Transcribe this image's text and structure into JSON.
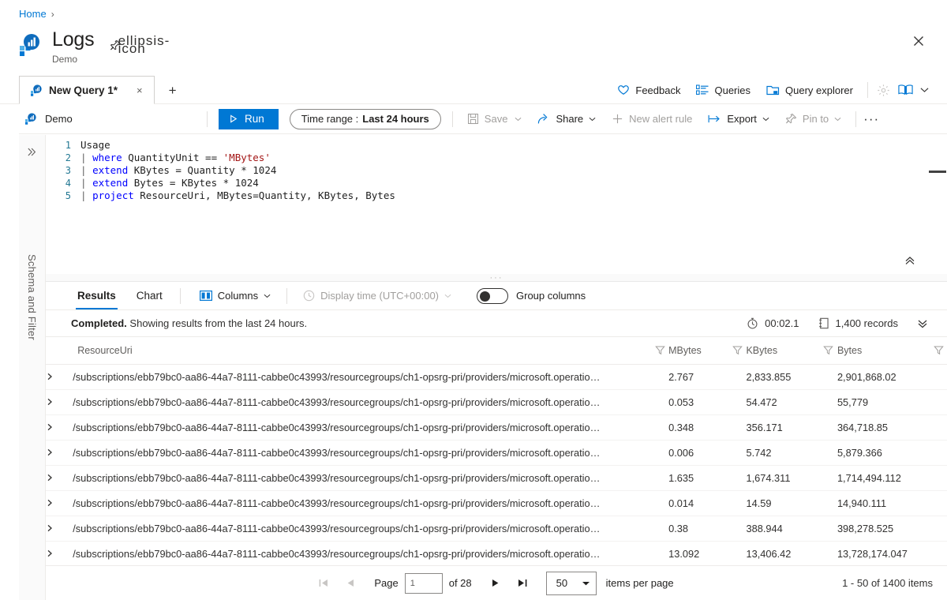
{
  "breadcrumb": {
    "home": "Home"
  },
  "header": {
    "title": "Logs",
    "subtitle": "Demo",
    "pin_icon": "pin-icon",
    "more_icon": "ellipsis-icon",
    "close_icon": "close-icon"
  },
  "tabs": {
    "items": [
      {
        "label": "New Query 1*",
        "icon": "log-analytics-icon",
        "close": "×"
      }
    ],
    "new_tab": "+"
  },
  "top_commands": [
    {
      "label": "Feedback",
      "icon": "heart-icon",
      "disabled": false
    },
    {
      "label": "Queries",
      "icon": "list-icon",
      "disabled": false
    },
    {
      "label": "Query explorer",
      "icon": "folder-open-icon",
      "disabled": false
    }
  ],
  "top_icon_commands": [
    {
      "name": "settings-gear-icon",
      "disabled": true
    },
    {
      "name": "book-help-icon",
      "disabled": false
    }
  ],
  "commandbar": {
    "scope_label": "Demo",
    "scope_icon": "log-analytics-icon",
    "run_label": "Run",
    "run_icon": "play-icon",
    "time_range_prefix": "Time range :",
    "time_range_value": "Last 24 hours",
    "items": [
      {
        "label": "Save",
        "icon": "save-icon",
        "caret": true,
        "disabled": true
      },
      {
        "label": "Share",
        "icon": "share-icon",
        "caret": true,
        "disabled": false
      },
      {
        "label": "New alert rule",
        "icon": "plus-icon",
        "caret": false,
        "disabled": true
      },
      {
        "label": "Export",
        "icon": "export-icon",
        "caret": true,
        "disabled": false
      },
      {
        "label": "Pin to",
        "icon": "pin-icon",
        "caret": true,
        "disabled": true
      }
    ],
    "overflow": "···"
  },
  "rail": {
    "expand_icon": "double-chevron-right-icon",
    "label": "Schema and Filter"
  },
  "editor": {
    "collapse_icon": "double-chevron-up-icon",
    "lines": [
      {
        "n": "1",
        "html": "Usage"
      },
      {
        "n": "2",
        "html": "<span class=\"pipe\">| </span><span class=\"kw\">where</span> QuantityUnit == <span class=\"str\">'MBytes'</span>"
      },
      {
        "n": "3",
        "html": "<span class=\"pipe\">| </span><span class=\"kw\">extend</span> KBytes = Quantity * <span class=\"num\">1024</span>"
      },
      {
        "n": "4",
        "html": "<span class=\"pipe\">| </span><span class=\"kw\">extend</span> Bytes = KBytes * <span class=\"num\">1024</span>"
      },
      {
        "n": "5",
        "html": "<span class=\"pipe\">| </span><span class=\"kw\">project</span> ResourceUri, MBytes=Quantity, KBytes, Bytes"
      }
    ],
    "query_text": "Usage\n| where QuantityUnit == 'MBytes'\n| extend KBytes = Quantity * 1024\n| extend Bytes = KBytes * 1024\n| project ResourceUri, MBytes=Quantity, KBytes, Bytes"
  },
  "splitter": {
    "grip": "···"
  },
  "results_toolbar": {
    "tabs": [
      {
        "label": "Results",
        "active": true
      },
      {
        "label": "Chart",
        "active": false
      }
    ],
    "columns_label": "Columns",
    "columns_icon": "columns-icon",
    "display_time_label": "Display time (UTC+00:00)",
    "display_time_icon": "clock-icon",
    "group_columns_label": "Group columns",
    "group_columns_on": false
  },
  "status": {
    "prefix": "Completed.",
    "message": "Showing results from the last 24 hours.",
    "elapsed": "00:02.1",
    "elapsed_icon": "stopwatch-icon",
    "records": "1,400 records",
    "records_icon": "records-icon",
    "expand_icon": "double-chevron-down-icon"
  },
  "table": {
    "columns": [
      "ResourceUri",
      "MBytes",
      "KBytes",
      "Bytes"
    ],
    "filter_icon": "filter-funnel-icon",
    "row_expand_icon": "chevron-right-icon",
    "rows": [
      {
        "uri": "/subscriptions/ebb79bc0-aa86-44a7-8111-cabbe0c43993/resourcegroups/ch1-opsrg-pri/providers/microsoft.operatio…",
        "mbytes": "2.767",
        "kbytes": "2,833.855",
        "bytes": "2,901,868.02"
      },
      {
        "uri": "/subscriptions/ebb79bc0-aa86-44a7-8111-cabbe0c43993/resourcegroups/ch1-opsrg-pri/providers/microsoft.operatio…",
        "mbytes": "0.053",
        "kbytes": "54.472",
        "bytes": "55,779"
      },
      {
        "uri": "/subscriptions/ebb79bc0-aa86-44a7-8111-cabbe0c43993/resourcegroups/ch1-opsrg-pri/providers/microsoft.operatio…",
        "mbytes": "0.348",
        "kbytes": "356.171",
        "bytes": "364,718.85"
      },
      {
        "uri": "/subscriptions/ebb79bc0-aa86-44a7-8111-cabbe0c43993/resourcegroups/ch1-opsrg-pri/providers/microsoft.operatio…",
        "mbytes": "0.006",
        "kbytes": "5.742",
        "bytes": "5,879.366"
      },
      {
        "uri": "/subscriptions/ebb79bc0-aa86-44a7-8111-cabbe0c43993/resourcegroups/ch1-opsrg-pri/providers/microsoft.operatio…",
        "mbytes": "1.635",
        "kbytes": "1,674.311",
        "bytes": "1,714,494.112"
      },
      {
        "uri": "/subscriptions/ebb79bc0-aa86-44a7-8111-cabbe0c43993/resourcegroups/ch1-opsrg-pri/providers/microsoft.operatio…",
        "mbytes": "0.014",
        "kbytes": "14.59",
        "bytes": "14,940.111"
      },
      {
        "uri": "/subscriptions/ebb79bc0-aa86-44a7-8111-cabbe0c43993/resourcegroups/ch1-opsrg-pri/providers/microsoft.operatio…",
        "mbytes": "0.38",
        "kbytes": "388.944",
        "bytes": "398,278.525"
      },
      {
        "uri": "/subscriptions/ebb79bc0-aa86-44a7-8111-cabbe0c43993/resourcegroups/ch1-opsrg-pri/providers/microsoft.operatio…",
        "mbytes": "13.092",
        "kbytes": "13,406.42",
        "bytes": "13,728,174.047"
      }
    ]
  },
  "pager": {
    "first_icon": "page-first-icon",
    "prev_icon": "page-prev-icon",
    "next_icon": "page-next-icon",
    "last_icon": "page-last-icon",
    "page_label": "Page",
    "page_value": "1",
    "of_label": "of 28",
    "page_size": "50",
    "page_size_label": "items per page",
    "total_label": "1 - 50 of 1400 items"
  },
  "colors": {
    "accent": "#0078d4",
    "link": "#0078d4",
    "text": "#201f1e",
    "muted": "#605e5c",
    "border": "#edebe9",
    "keyword": "#0000ff",
    "string": "#a31515"
  }
}
